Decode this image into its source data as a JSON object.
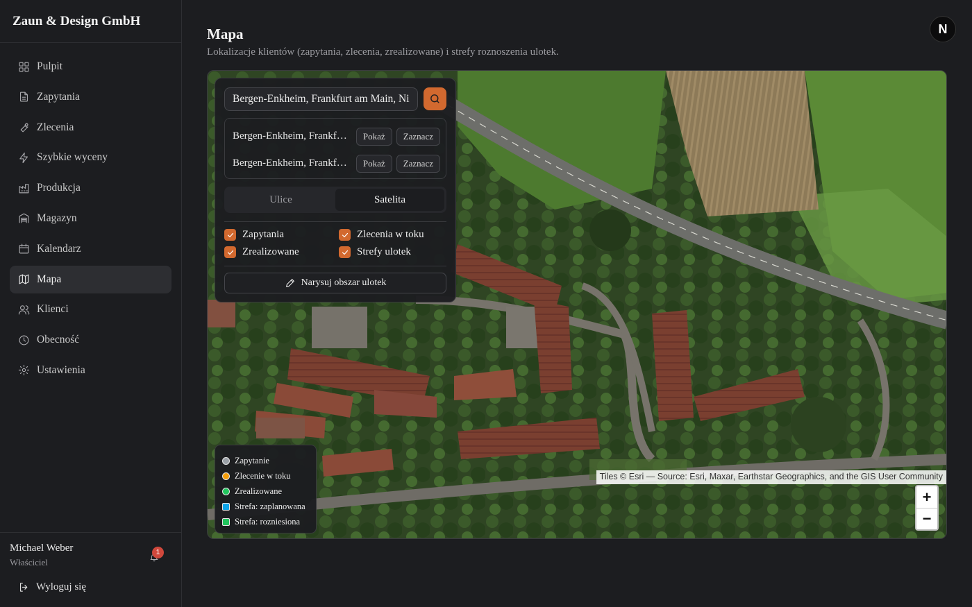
{
  "app": {
    "brand": "Zaun & Design GmbH"
  },
  "sidebar": {
    "items": [
      {
        "label": "Pulpit",
        "icon": "dashboard-icon"
      },
      {
        "label": "Zapytania",
        "icon": "document-icon"
      },
      {
        "label": "Zlecenia",
        "icon": "wrench-icon"
      },
      {
        "label": "Szybkie wyceny",
        "icon": "lightning-icon"
      },
      {
        "label": "Produkcja",
        "icon": "factory-icon"
      },
      {
        "label": "Magazyn",
        "icon": "warehouse-icon"
      },
      {
        "label": "Kalendarz",
        "icon": "calendar-icon"
      },
      {
        "label": "Mapa",
        "icon": "map-icon",
        "active": true
      },
      {
        "label": "Klienci",
        "icon": "users-icon"
      },
      {
        "label": "Obecność",
        "icon": "clock-icon"
      },
      {
        "label": "Ustawienia",
        "icon": "gear-icon"
      }
    ]
  },
  "user": {
    "name": "Michael Weber",
    "role": "Właściciel",
    "notifications": "1",
    "logout_label": "Wyloguj się"
  },
  "header": {
    "title": "Mapa",
    "subtitle": "Lokalizacje klientów (zapytania, zlecenia, zrealizowane) i strefy roznoszenia ulotek.",
    "avatar_letter": "N"
  },
  "map": {
    "search": {
      "value": "Bergen-Enkheim, Frankfurt am Main, Niderrad"
    },
    "results": [
      {
        "text": "Bergen-Enkheim, Frankfurt am Main",
        "show_label": "Pokaż",
        "mark_label": "Zaznacz"
      },
      {
        "text": "Bergen-Enkheim, Frankfurt am Main",
        "show_label": "Pokaż",
        "mark_label": "Zaznacz"
      }
    ],
    "layers": {
      "streets": "Ulice",
      "satellite": "Satelita",
      "active": "satellite"
    },
    "filters": {
      "inquiries": "Zapytania",
      "orders_in_progress": "Zlecenia w toku",
      "completed": "Zrealizowane",
      "flyer_zones": "Strefy ulotek"
    },
    "draw_button": "Narysuj obszar ulotek",
    "legend": [
      {
        "label": "Zapytanie",
        "color": "#9aa0a6",
        "shape": "dot"
      },
      {
        "label": "Zlecenie w toku",
        "color": "#f59e0b",
        "shape": "dot"
      },
      {
        "label": "Zrealizowane",
        "color": "#22c55e",
        "shape": "dot"
      },
      {
        "label": "Strefa: zaplanowana",
        "color": "#0ea5e9",
        "shape": "square"
      },
      {
        "label": "Strefa: rozniesiona",
        "color": "#22c55e",
        "shape": "square"
      }
    ],
    "attribution": "Tiles © Esri — Source: Esri, Maxar, Earthstar Geographics, and the GIS User Community",
    "zoom_in": "+",
    "zoom_out": "−"
  },
  "colors": {
    "accent": "#d2692f",
    "background": "#1c1d20",
    "badge": "#d0483c"
  }
}
